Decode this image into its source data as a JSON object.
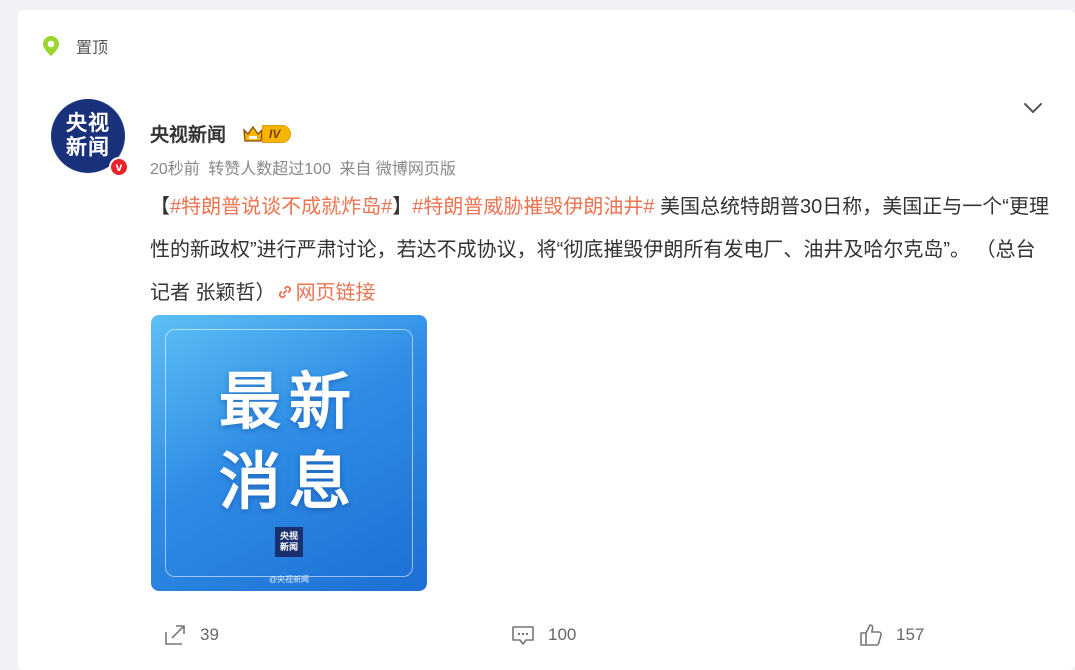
{
  "pinned": {
    "label": "置顶",
    "icon": "pin-location-icon"
  },
  "post": {
    "avatar": {
      "line1": "央视",
      "line2": "新闻",
      "verified_mark": "v"
    },
    "username": "央视新闻",
    "level": {
      "icon": "crown-icon",
      "label": "IV"
    },
    "meta": {
      "time": "20秒前",
      "stat": "转赞人数超过100",
      "source": "来自 微博网页版"
    },
    "content": {
      "bracket_open": "【",
      "tag1": "#特朗普说谈不成就炸岛#",
      "bracket_close": "】",
      "tag2": "#特朗普威胁摧毁伊朗油井#",
      "body": " 美国总统特朗普30日称，美国正与一个“更理性的新政权”进行严肃讨论，若达不成协议，将“彻底摧毁伊朗所有发电厂、油井及哈尔克岛”。 （总台记者 张颖哲）",
      "link_label": "网页链接",
      "link_icon": "link-icon"
    },
    "image": {
      "headline_line1": "最新",
      "headline_line2": "消息",
      "mini_logo_line1": "央视",
      "mini_logo_line2": "新闻",
      "watermark": "@央视新闻"
    },
    "actions": {
      "share": {
        "icon": "share-icon",
        "count": "39"
      },
      "comment": {
        "icon": "comment-icon",
        "count": "100"
      },
      "like": {
        "icon": "thumbs-up-icon",
        "count": "157"
      }
    }
  },
  "colors": {
    "accent": "#eb7350",
    "avatar_bg": "#19317a",
    "verified": "#e8232a",
    "pin": "#9bd42f"
  }
}
